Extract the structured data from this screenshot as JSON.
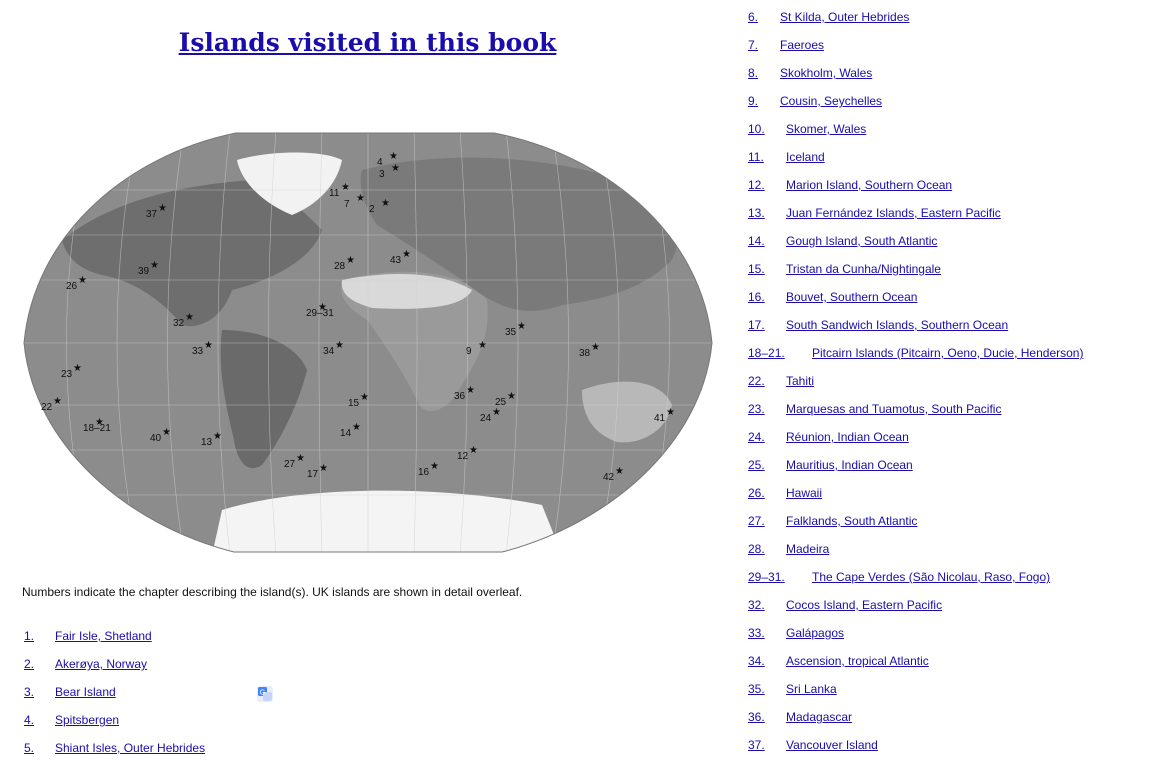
{
  "title": "Islands visited in this book",
  "caption": "Numbers indicate the chapter describing the island(s). UK islands are shown in detail overleaf.",
  "map_labels": [
    "4",
    "3",
    "11",
    "7",
    "2",
    "37",
    "28",
    "43",
    "39",
    "26",
    "29–31",
    "35",
    "32",
    "33",
    "34",
    "9",
    "38",
    "23",
    "15",
    "36",
    "25",
    "22",
    "18–21",
    "24",
    "41",
    "40",
    "13",
    "14",
    "12",
    "27",
    "17",
    "16",
    "42"
  ],
  "left_list": [
    {
      "num": "1.",
      "text": "Fair Isle, Shetland"
    },
    {
      "num": "2.",
      "text": "Akerøya, Norway"
    },
    {
      "num": "3.",
      "text": "Bear Island"
    },
    {
      "num": "4.",
      "text": "Spitsbergen"
    },
    {
      "num": "5.",
      "text": "Shiant Isles, Outer Hebrides"
    }
  ],
  "right_list": [
    {
      "num": "6.",
      "text": "St Kilda, Outer Hebrides"
    },
    {
      "num": "7.",
      "text": "Faeroes"
    },
    {
      "num": "8.",
      "text": "Skokholm, Wales"
    },
    {
      "num": "9.",
      "text": "Cousin, Seychelles"
    },
    {
      "num": "10.",
      "text": "Skomer, Wales"
    },
    {
      "num": "11.",
      "text": "Iceland"
    },
    {
      "num": "12.",
      "text": "Marion Island, Southern Ocean"
    },
    {
      "num": "13.",
      "text": "Juan Fernández Islands, Eastern Pacific"
    },
    {
      "num": "14.",
      "text": "Gough Island, South Atlantic"
    },
    {
      "num": "15.",
      "text": "Tristan da Cunha/Nightingale"
    },
    {
      "num": "16.",
      "text": "Bouvet, Southern Ocean"
    },
    {
      "num": "17.",
      "text": "South Sandwich Islands, Southern Ocean"
    },
    {
      "num": "18–21.",
      "text": "Pitcairn Islands (Pitcairn, Oeno, Ducie, Henderson)"
    },
    {
      "num": "22.",
      "text": "Tahiti"
    },
    {
      "num": "23.",
      "text": "Marquesas and Tuamotus, South Pacific"
    },
    {
      "num": "24.",
      "text": "Réunion, Indian Ocean"
    },
    {
      "num": "25.",
      "text": "Mauritius, Indian Ocean"
    },
    {
      "num": "26.",
      "text": "Hawaii"
    },
    {
      "num": "27.",
      "text": "Falklands, South Atlantic"
    },
    {
      "num": "28.",
      "text": "Madeira"
    },
    {
      "num": "29–31.",
      "text": "The Cape Verdes (São Nicolau, Raso, Fogo)"
    },
    {
      "num": "32.",
      "text": "Cocos Island, Eastern Pacific"
    },
    {
      "num": "33.",
      "text": "Galápagos"
    },
    {
      "num": "34.",
      "text": "Ascension, tropical Atlantic"
    },
    {
      "num": "35.",
      "text": "Sri Lanka"
    },
    {
      "num": "36.",
      "text": "Madagascar"
    },
    {
      "num": "37.",
      "text": "Vancouver Island"
    }
  ]
}
